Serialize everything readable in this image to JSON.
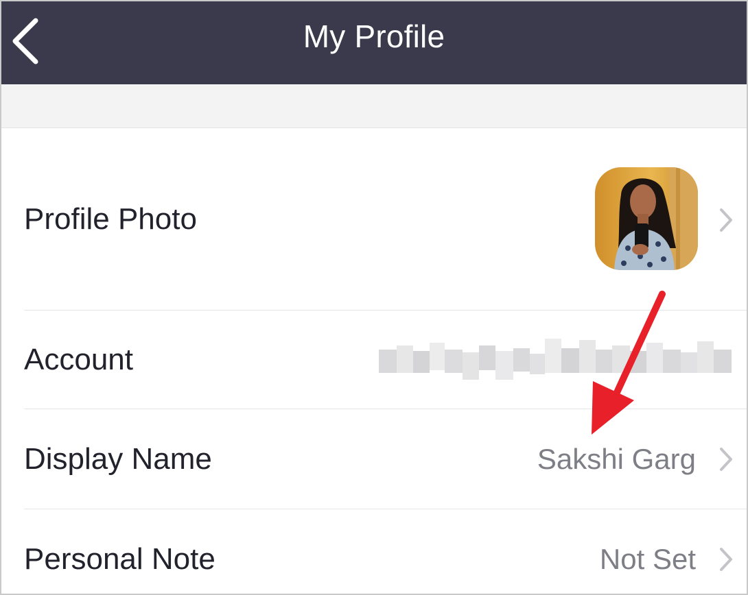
{
  "navbar": {
    "title": "My Profile",
    "back_icon": "chevron-left-icon"
  },
  "rows": [
    {
      "label": "Profile Photo",
      "value": ""
    },
    {
      "label": "Account",
      "value": ""
    },
    {
      "label": "Display Name",
      "value": "Sakshi Garg"
    },
    {
      "label": "Personal Note",
      "value": "Not Set"
    }
  ],
  "colors": {
    "navbar_bg": "#3a3a4c",
    "annotation_arrow": "#e8202a",
    "value_text": "#7e7e86"
  }
}
